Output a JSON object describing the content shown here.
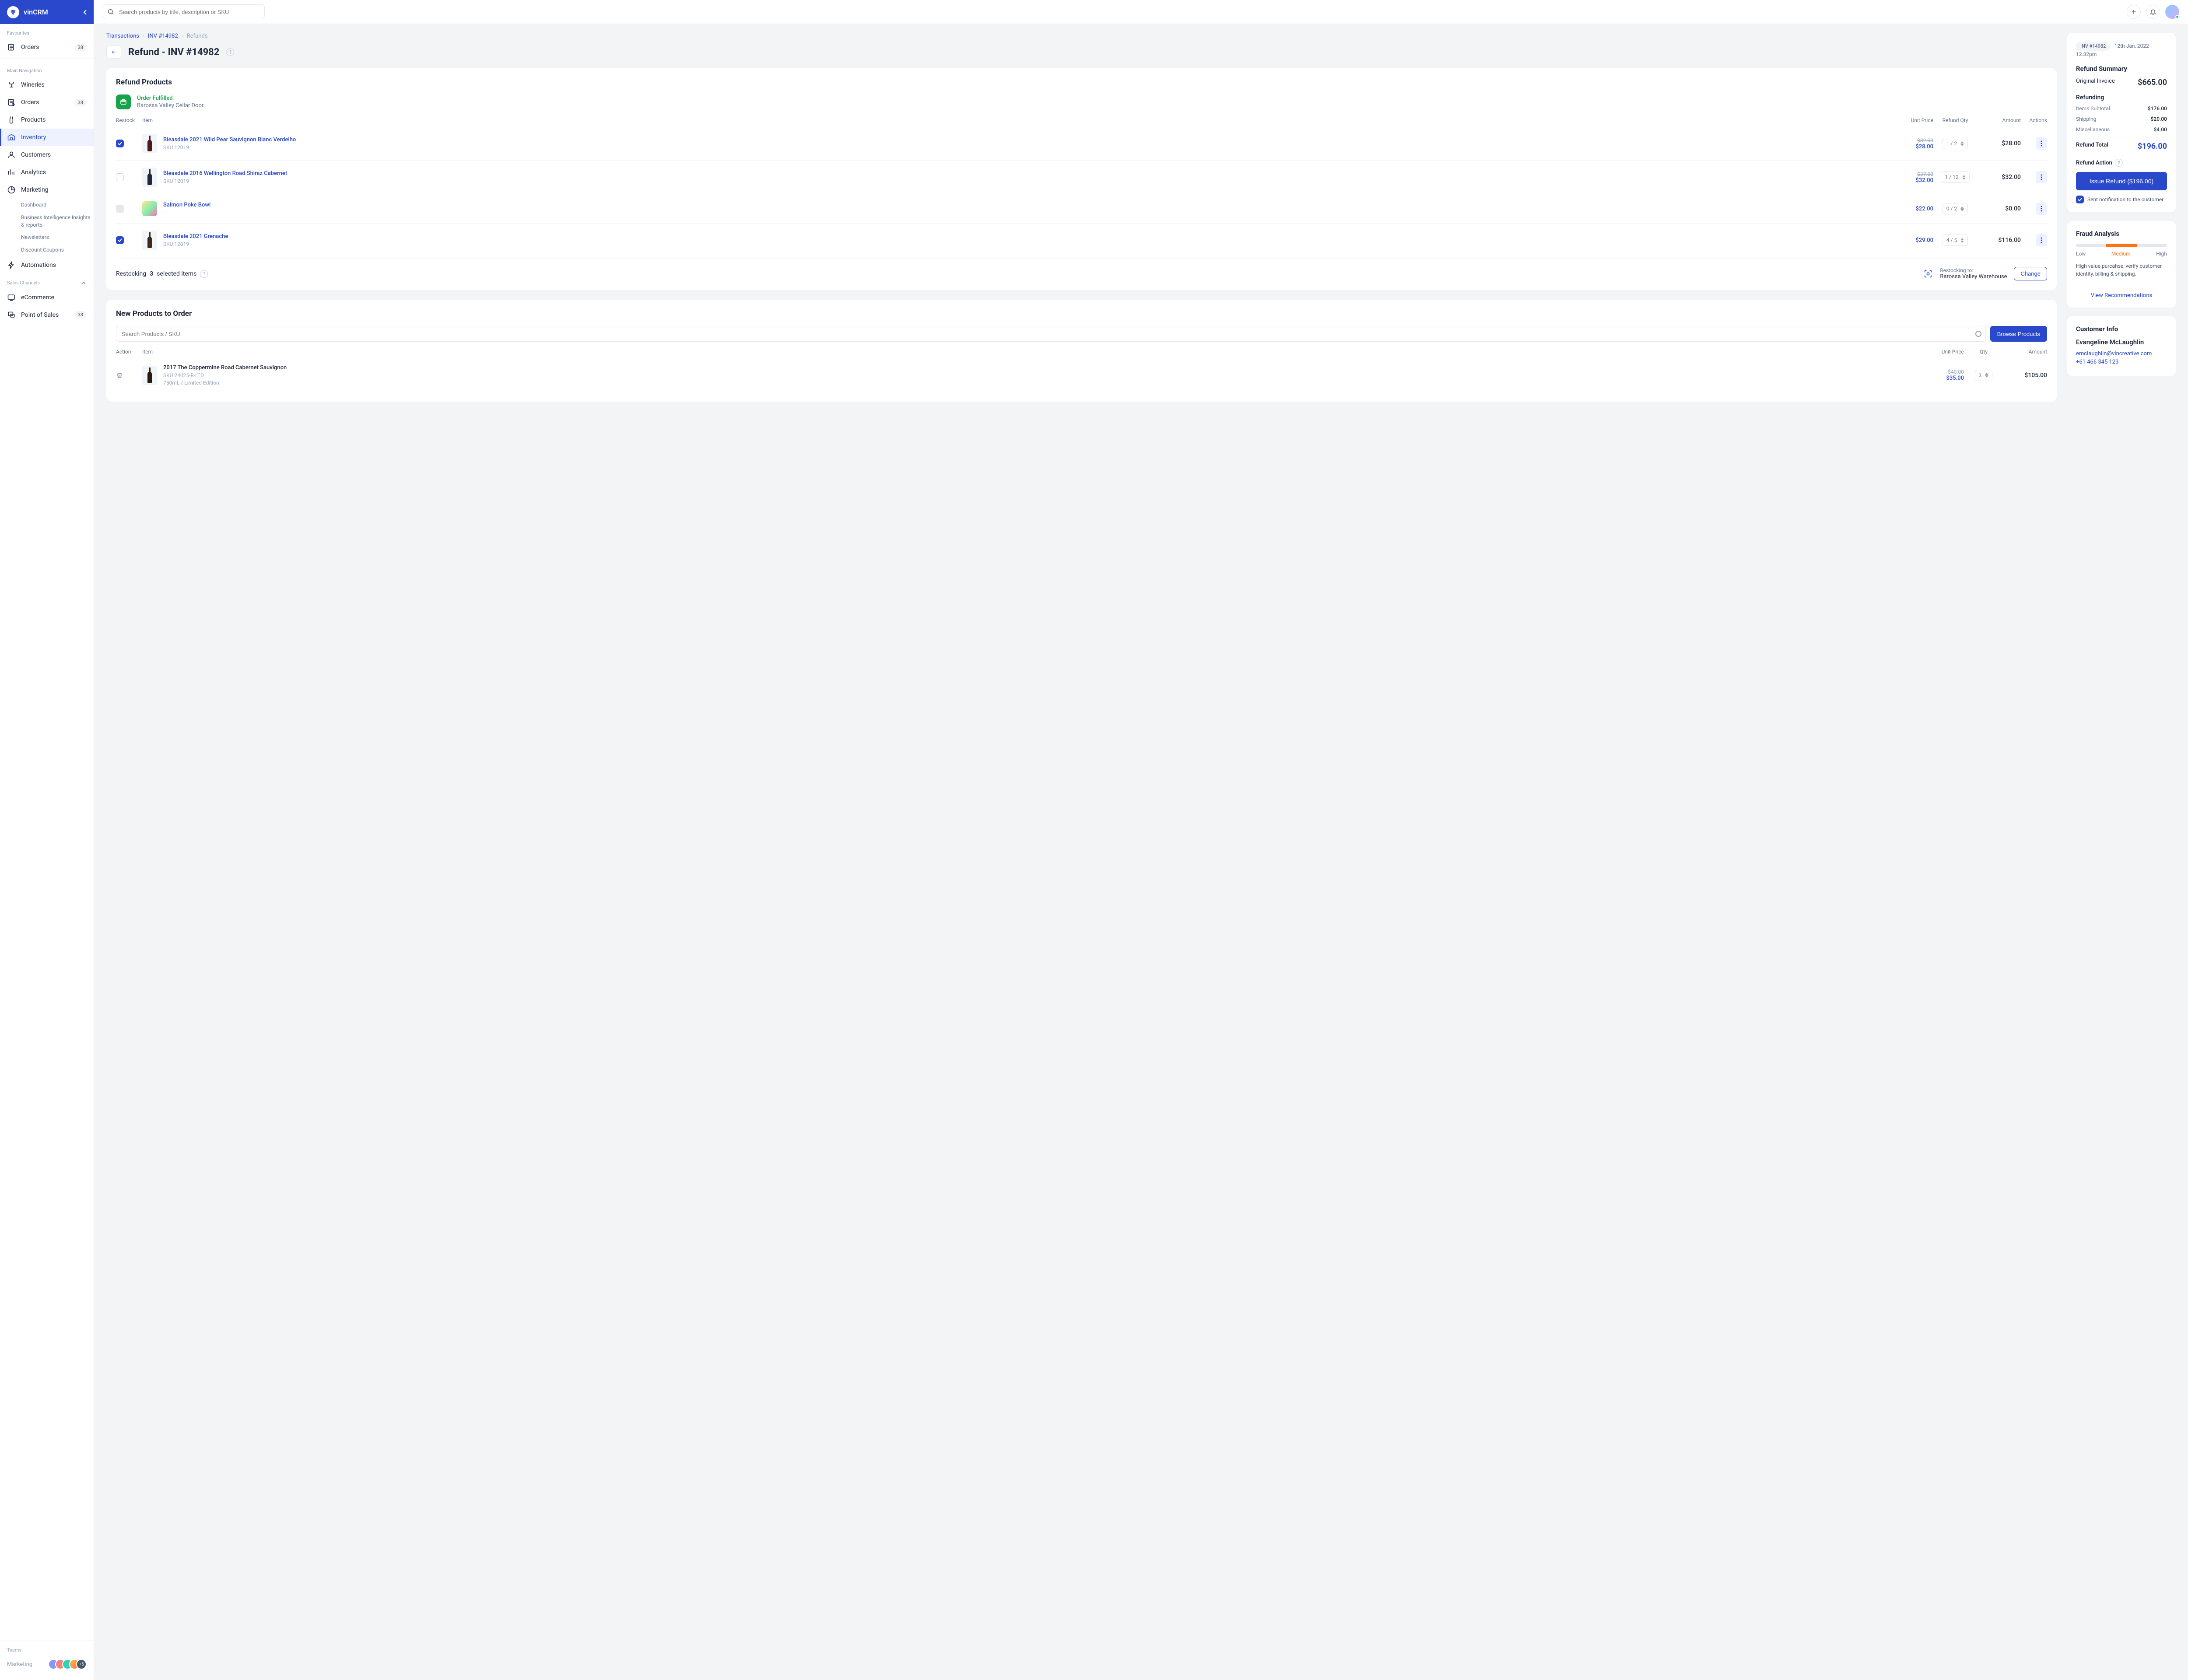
{
  "brand": "vinCRM",
  "search": {
    "placeholder": "Search products by title, description or SKU"
  },
  "sidebar": {
    "favourites_label": "Favourites",
    "fav_items": [
      {
        "label": "Orders",
        "badge": "38"
      }
    ],
    "main_label": "Main Navigation",
    "main_items": [
      {
        "label": "Wineries"
      },
      {
        "label": "Orders",
        "badge": "38"
      },
      {
        "label": "Products"
      },
      {
        "label": "Inventory",
        "active": true
      },
      {
        "label": "Customers"
      },
      {
        "label": "Analytics"
      },
      {
        "label": "Marketing"
      }
    ],
    "marketing_sub": [
      "Dashboard",
      "Business Intelligence Insights & reports.",
      "Newsletters",
      "Discount Coupons"
    ],
    "automations_label": "Automations",
    "channels_label": "Sales Channels",
    "channel_items": [
      {
        "label": "eCommerce"
      },
      {
        "label": "Point of Sales",
        "badge": "38"
      }
    ],
    "teams_label": "Teams",
    "team_name": "Marketing",
    "team_more": "+5"
  },
  "breadcrumb": {
    "a": "Transactions",
    "b": "INV #14982",
    "c": "Refunds"
  },
  "page_title": "Refund - INV #14982",
  "refund_products": {
    "title": "Refund Products",
    "status": "Order Fulfilled",
    "location": "Barossa Valley Cellar Door",
    "headers": {
      "restock": "Restock",
      "item": "Item",
      "unit": "Unit Price",
      "qty": "Refund Qty",
      "amount": "Amount",
      "actions": "Actions"
    },
    "rows": [
      {
        "checked": true,
        "name": "Bleasdale 2021 Wild Pear Sauvignon Blanc Verdelho",
        "sku": "SKU 12019",
        "oldPrice": "$32.00",
        "price": "$28.00",
        "qty": "1 / 2",
        "amount": "$28.00",
        "type": "wine",
        "bottle": "#4b1c1c"
      },
      {
        "checked": false,
        "name": "Bleasdale 2016 Wellington Road Shiraz Cabernet",
        "sku": "SKU 12019",
        "oldPrice": "$37.00",
        "price": "$32.00",
        "qty": "1 / 12",
        "amount": "$32.00",
        "type": "wine",
        "bottle": "#1e293b"
      },
      {
        "checked": "disabled",
        "name": "Salmon Poke Bowl",
        "sku": "-",
        "oldPrice": "",
        "price": "$22.00",
        "qty": "0 / 2",
        "amount": "$0.00",
        "type": "food"
      },
      {
        "checked": true,
        "name": "Bleasdale 2021 Grenache",
        "sku": "SKU 12019",
        "oldPrice": "",
        "price": "$29.00",
        "qty": "4 / 5",
        "amount": "$116.00",
        "type": "wine",
        "bottle": "#3b2a1a"
      }
    ],
    "footer": {
      "pre": "Restocking ",
      "count": "3",
      "post": " selected items",
      "restock_label": "Restocking to:",
      "restock_loc": "Barossa Valley Warehouse",
      "change": "Change"
    }
  },
  "new_products": {
    "title": "New Products to Order",
    "search_placeholder": "Search Products / SKU",
    "browse": "Browse Products",
    "headers": {
      "action": "Action",
      "item": "Item",
      "unit": "Unit Price",
      "qty": "Qty",
      "amount": "Amount"
    },
    "row": {
      "name": "2017 The Coppermine Road Cabernet Sauvignon",
      "sku": "SKU 24025-R-LTD",
      "variant": "750mL / Limited Edition",
      "oldPrice": "$40.00",
      "price": "$35.00",
      "qty": "3",
      "amount": "$105.00",
      "bottle": "#2a1810"
    }
  },
  "summary": {
    "pill": "INV #14982",
    "date": "12th Jan, 2022 - 12.32pm",
    "title": "Refund Summary",
    "original_label": "Original Invoice",
    "original_value": "$665.00",
    "refunding_label": "Refunding",
    "subtotal_label": "Items Subtotal",
    "subtotal_value": "$176.00",
    "shipping_label": "Shipping",
    "shipping_value": "$20.00",
    "misc_label": "Miscellaneous",
    "misc_value": "$4.00",
    "total_label": "Refund Total",
    "total_value": "$196.00",
    "action_label": "Refund Action",
    "button": "Issue Refund ($196.00)",
    "notify": "Sent notification to the customer."
  },
  "fraud": {
    "title": "Fraud Analysis",
    "low": "Low",
    "med": "Medium",
    "high": "High",
    "desc": "High value purcahse, verify customer identity, billing & shipping.",
    "link": "View Recommendations"
  },
  "customer": {
    "title": "Customer Info",
    "name": "Evangeline McLaughlin",
    "email": "emclaughlin@vincreative.com",
    "phone": "+61 466 345 123"
  }
}
